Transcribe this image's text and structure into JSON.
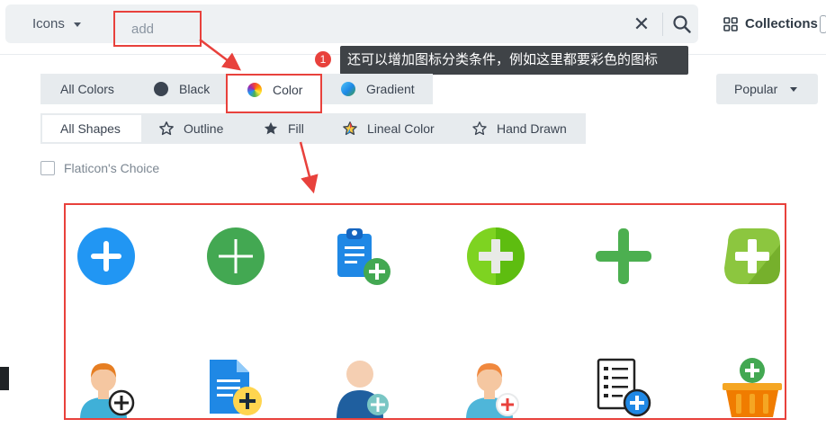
{
  "search": {
    "type_label": "Icons",
    "query_value": "add",
    "collections_label": "Collections"
  },
  "annotation": {
    "badge_number": "1",
    "tooltip_text": "还可以增加图标分类条件，例如这里都要彩色的图标"
  },
  "color_filters": [
    {
      "label": "All Colors",
      "swatch": "none"
    },
    {
      "label": "Black",
      "swatch": "#3b4451"
    },
    {
      "label": "Color",
      "swatch": "rainbow",
      "selected": true
    },
    {
      "label": "Gradient",
      "swatch": "gradient"
    }
  ],
  "sort": {
    "label": "Popular"
  },
  "shape_filters": [
    {
      "label": "All Shapes",
      "icon": "none",
      "selected": true
    },
    {
      "label": "Outline",
      "icon": "star-outline-icon"
    },
    {
      "label": "Fill",
      "icon": "star-fill-icon"
    },
    {
      "label": "Lineal Color",
      "icon": "star-lineal-color-icon"
    },
    {
      "label": "Hand Drawn",
      "icon": "star-hand-drawn-icon"
    }
  ],
  "flaticon_choice": {
    "label": "Flaticon's Choice",
    "checked": false
  },
  "colors": {
    "accent_red": "#e8413c",
    "toolbar_bg": "#e7ebee",
    "text": "#3b4451"
  },
  "results": [
    {
      "name": "blue-circle-add-icon"
    },
    {
      "name": "green-circle-add-icon"
    },
    {
      "name": "clipboard-add-icon"
    },
    {
      "name": "lime-circle-add-icon"
    },
    {
      "name": "green-plus-icon"
    },
    {
      "name": "green-rounded-square-add-icon"
    },
    {
      "name": "user-headset-add-icon"
    },
    {
      "name": "document-add-icon"
    },
    {
      "name": "user-add-icon"
    },
    {
      "name": "user-add-red-icon"
    },
    {
      "name": "checklist-add-icon"
    },
    {
      "name": "basket-add-icon"
    }
  ]
}
